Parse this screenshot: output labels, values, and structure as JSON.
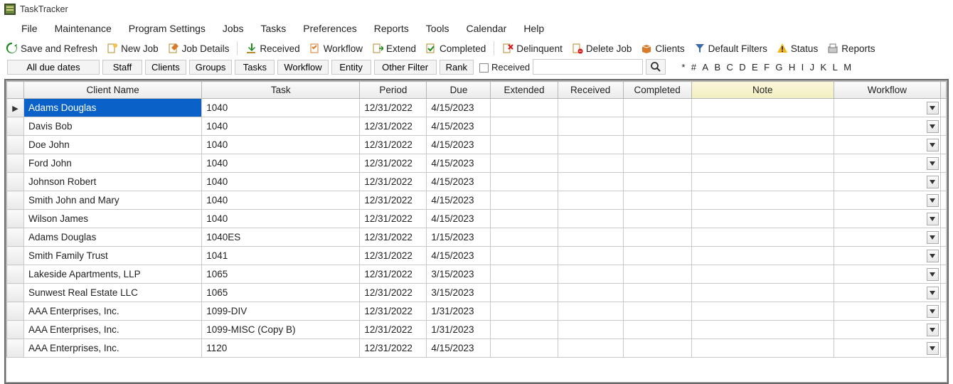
{
  "app": {
    "title": "TaskTracker"
  },
  "menu": {
    "items": [
      "File",
      "Maintenance",
      "Program Settings",
      "Jobs",
      "Tasks",
      "Preferences",
      "Reports",
      "Tools",
      "Calendar",
      "Help"
    ]
  },
  "toolbar": {
    "save_refresh": "Save and Refresh",
    "new_job": "New Job",
    "job_details": "Job Details",
    "received": "Received",
    "workflow": "Workflow",
    "extend": "Extend",
    "completed": "Completed",
    "delinquent": "Delinquent",
    "delete_job": "Delete Job",
    "clients": "Clients",
    "default_filters": "Default Filters",
    "status": "Status",
    "reports": "Reports"
  },
  "filters": {
    "all_due_dates": "All due dates",
    "staff": "Staff",
    "clients": "Clients",
    "groups": "Groups",
    "tasks": "Tasks",
    "workflow": "Workflow",
    "entity": "Entity",
    "other_filter": "Other Filter",
    "rank": "Rank",
    "received_chk_label": "Received",
    "search_value": "",
    "alpha": [
      "*",
      "#",
      "A",
      "B",
      "C",
      "D",
      "E",
      "F",
      "G",
      "H",
      "I",
      "J",
      "K",
      "L",
      "M"
    ]
  },
  "grid": {
    "headers": {
      "client": "Client Name",
      "task": "Task",
      "period": "Period",
      "due": "Due",
      "extended": "Extended",
      "received": "Received",
      "completed": "Completed",
      "note": "Note",
      "workflow": "Workflow"
    },
    "rows": [
      {
        "client": "Adams Douglas",
        "task": "1040",
        "period": "12/31/2022",
        "due": "4/15/2023",
        "selected": true
      },
      {
        "client": "Davis Bob",
        "task": "1040",
        "period": "12/31/2022",
        "due": "4/15/2023"
      },
      {
        "client": "Doe John",
        "task": "1040",
        "period": "12/31/2022",
        "due": "4/15/2023"
      },
      {
        "client": "Ford John",
        "task": "1040",
        "period": "12/31/2022",
        "due": "4/15/2023"
      },
      {
        "client": "Johnson Robert",
        "task": "1040",
        "period": "12/31/2022",
        "due": "4/15/2023"
      },
      {
        "client": "Smith John and Mary",
        "task": "1040",
        "period": "12/31/2022",
        "due": "4/15/2023"
      },
      {
        "client": "Wilson James",
        "task": "1040",
        "period": "12/31/2022",
        "due": "4/15/2023"
      },
      {
        "client": "Adams Douglas",
        "task": "1040ES",
        "period": "12/31/2022",
        "due": "1/15/2023"
      },
      {
        "client": "Smith Family Trust",
        "task": "1041",
        "period": "12/31/2022",
        "due": "4/15/2023"
      },
      {
        "client": "Lakeside Apartments, LLP",
        "task": "1065",
        "period": "12/31/2022",
        "due": "3/15/2023"
      },
      {
        "client": "Sunwest Real Estate LLC",
        "task": "1065",
        "period": "12/31/2022",
        "due": "3/15/2023"
      },
      {
        "client": "AAA Enterprises, Inc.",
        "task": "1099-DIV",
        "period": "12/31/2022",
        "due": "1/31/2023"
      },
      {
        "client": "AAA Enterprises, Inc.",
        "task": "1099-MISC (Copy B)",
        "period": "12/31/2022",
        "due": "1/31/2023"
      },
      {
        "client": "AAA Enterprises, Inc.",
        "task": "1120",
        "period": "12/31/2022",
        "due": "4/15/2023"
      }
    ]
  }
}
